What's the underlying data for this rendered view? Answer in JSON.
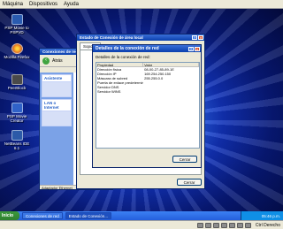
{
  "vbox_menu": [
    "Máquina",
    "Dispositivos",
    "Ayuda"
  ],
  "desktop_icons": [
    {
      "label": "PSP Movie to PSPVD",
      "icon": "psp-movie-icon",
      "color": "#2a5bb0"
    },
    {
      "label": "Mozilla Firefox",
      "icon": "firefox-icon",
      "color": "#e8761e"
    },
    {
      "label": "PeerBlock",
      "icon": "peerblock-icon",
      "color": "#4a4a4a"
    },
    {
      "label": "PSP Movie Creator",
      "icon": "psp-creator-icon",
      "color": "#3062c8"
    },
    {
      "label": "NetBeans IDE 6.1",
      "icon": "netbeans-icon",
      "color": "#2c5aa8"
    }
  ],
  "connections_window": {
    "title": "Conexiones de red",
    "back_label": "Atrás",
    "panel_assistant": "Asistente",
    "panel_lan": "LAN o Internet",
    "status_text": "Adaptador Ethernet"
  },
  "status_window": {
    "title": "Estado de Conexión de área local",
    "tab_support": "Soporte",
    "close_label": "Cerrar"
  },
  "details_dialog": {
    "title": "Detalles de la conexión de red",
    "subtitle": "Detalles de la conexión de red:",
    "col_property": "Propiedad",
    "col_value": "Valor",
    "rows": [
      {
        "property": "Dirección física",
        "value": "08-00-27-85-89-1E"
      },
      {
        "property": "Dirección IP",
        "value": "169.254.250.150"
      },
      {
        "property": "Máscara de subred",
        "value": "255.255.0.0"
      },
      {
        "property": "Puerta de enlace predetermin.",
        "value": ""
      },
      {
        "property": "Servidor DNS",
        "value": ""
      },
      {
        "property": "Servidor WINS",
        "value": ""
      }
    ],
    "close_label": "Cerrar"
  },
  "taskbar": {
    "start_label": "Inicio",
    "tasks": [
      "Conexiones de red",
      "Estado de Conexión..."
    ],
    "clock": "05:46 p.m."
  },
  "vbox_status": {
    "host_key": "Ctrl Derecho"
  }
}
